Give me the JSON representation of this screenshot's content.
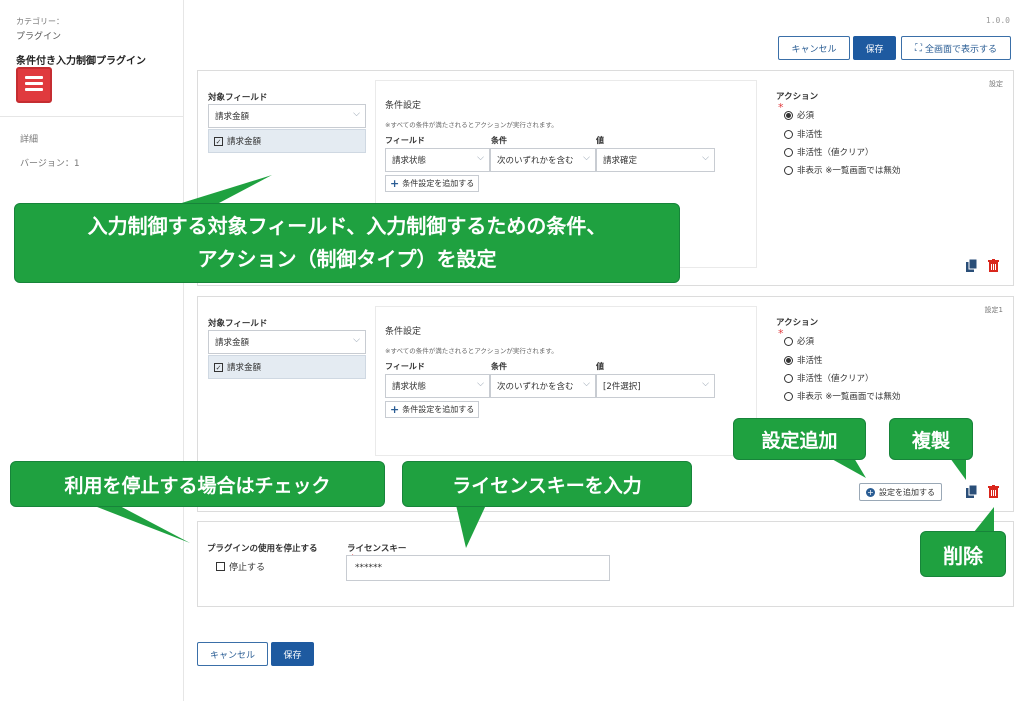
{
  "sidebar": {
    "category_label": "カテゴリー：",
    "category_value": "プラグイン",
    "plugin_name": "条件付き入力制御プラグイン",
    "detail": "詳細",
    "version": "バージョン：1"
  },
  "header": {
    "version": "1.0.0",
    "cancel_label": "キャンセル",
    "save_label": "保存",
    "fullscreen_label": "全画面で表示する"
  },
  "settings": [
    {
      "tag": "設定",
      "target_label": "対象フィールド",
      "target_select": "請求金額",
      "target_selected": "請求金額",
      "cond_title": "条件設定",
      "cond_note": "※すべての条件が満たされるとアクションが実行されます。",
      "col_field": "フィールド",
      "col_cond": "条件",
      "col_value": "値",
      "field_value": "請求状態",
      "cond_value": "次のいずれかを含む",
      "value_value": "請求確定",
      "add_cond": "条件設定を追加する",
      "action_label": "アクション",
      "actions": [
        "必須",
        "非活性",
        "非活性（値クリア）",
        "非表示 ※一覧画面では無効"
      ],
      "selected_action": 0
    },
    {
      "tag": "設定1",
      "target_label": "対象フィールド",
      "target_select": "請求金額",
      "target_selected": "請求金額",
      "cond_title": "条件設定",
      "cond_note": "※すべての条件が満たされるとアクションが実行されます。",
      "col_field": "フィールド",
      "col_cond": "条件",
      "col_value": "値",
      "field_value": "請求状態",
      "cond_value": "次のいずれかを含む",
      "value_value": "[2件選択]",
      "add_cond": "条件設定を追加する",
      "action_label": "アクション",
      "actions": [
        "必須",
        "非活性",
        "非活性（値クリア）",
        "非表示 ※一覧画面では無効"
      ],
      "selected_action": 1
    }
  ],
  "add_setting_label": "設定を追加する",
  "license": {
    "stop_label": "プラグインの使用を停止する",
    "stop_checkbox": "停止する",
    "key_label": "ライセンスキー",
    "key_value": "******"
  },
  "footer": {
    "cancel_label": "キャンセル",
    "save_label": "保存"
  },
  "callouts": {
    "main_line1": "入力制御する対象フィールド、入力制御するための条件、",
    "main_line2": "アクション（制御タイプ）を設定",
    "add_setting": "設定追加",
    "duplicate": "複製",
    "stop": "利用を停止する場合はチェック",
    "license": "ライセンスキーを入力",
    "delete": "削除"
  },
  "colors": {
    "accent": "#1e5aa0",
    "callout": "#1fa140",
    "delete": "#d9261c",
    "plugin_icon": "#e03a3e"
  }
}
